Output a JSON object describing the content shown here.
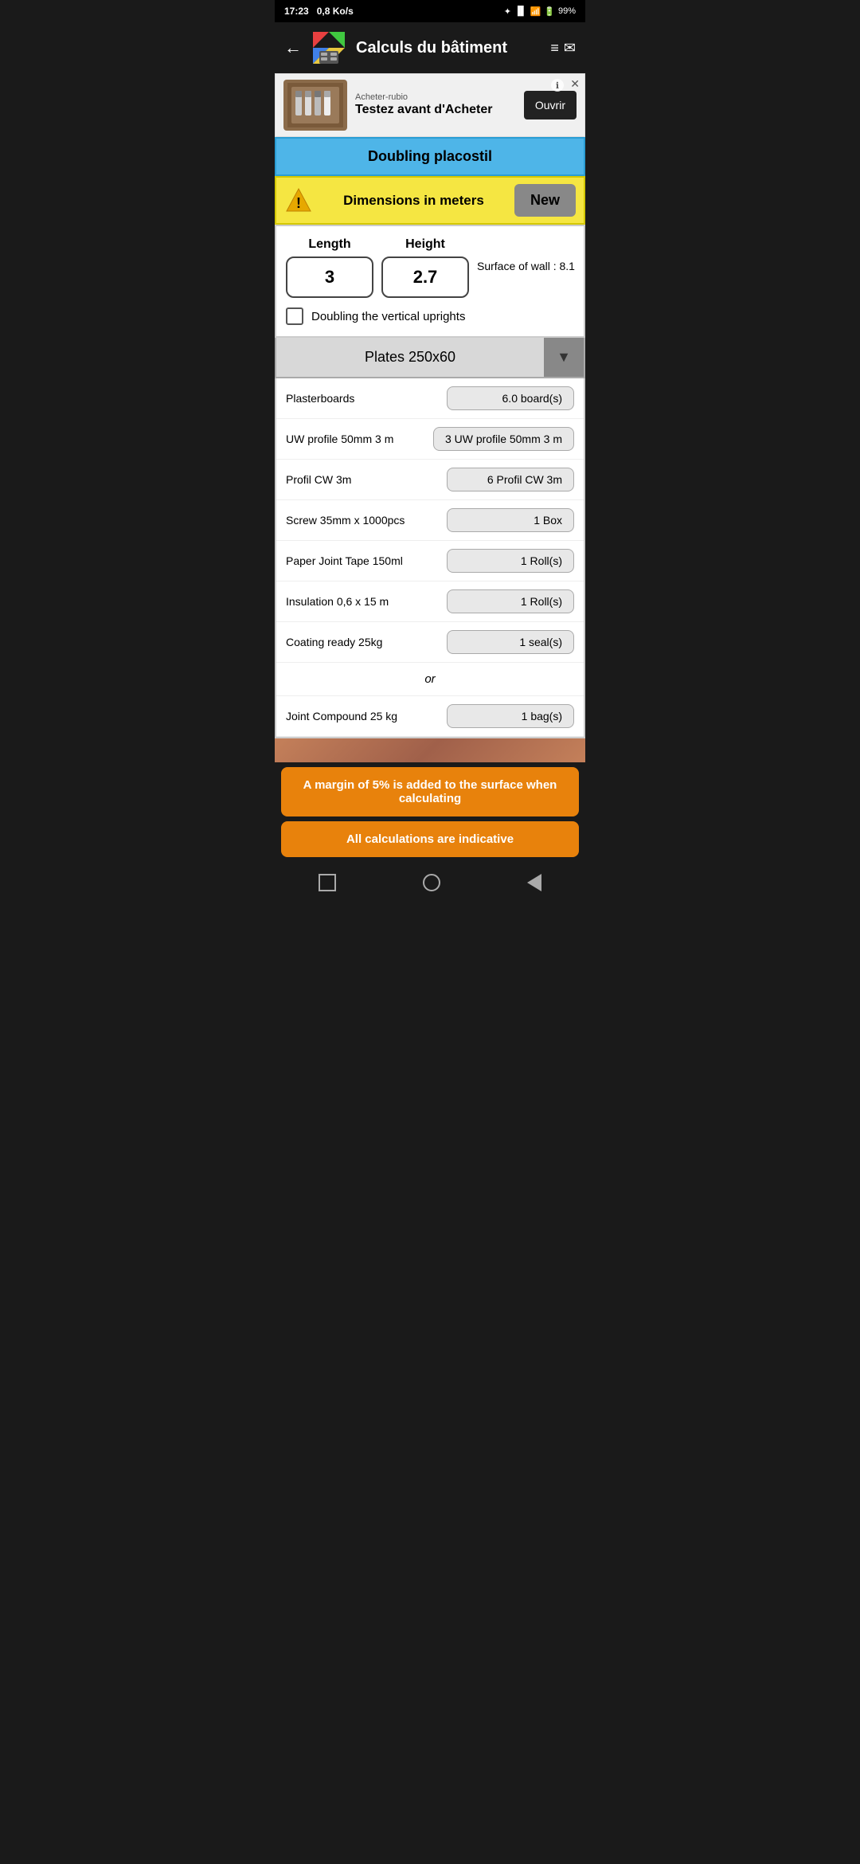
{
  "status_bar": {
    "time": "17:23",
    "network_speed": "0,8 Ko/s",
    "battery": "99%"
  },
  "header": {
    "back_label": "←",
    "title": "Calculs du bâtiment",
    "menu_icon": "≡✉"
  },
  "ad": {
    "source": "Acheter-rubio",
    "title": "Testez avant d'Acheter",
    "button_label": "Ouvrir",
    "info_label": "ℹ",
    "close_label": "✕"
  },
  "section": {
    "title": "Doubling placostil"
  },
  "dimensions_bar": {
    "text": "Dimensions in meters",
    "new_button": "New"
  },
  "inputs": {
    "length_label": "Length",
    "length_value": "3",
    "height_label": "Height",
    "height_value": "2.7",
    "surface_label": "Surface of wall :",
    "surface_value": "8.1",
    "checkbox_label": "Doubling the vertical uprights",
    "checkbox_checked": false
  },
  "dropdown": {
    "label": "Plates 250x60",
    "arrow": "▼"
  },
  "results": [
    {
      "label": "Plasterboards",
      "value": "6.0 board(s)"
    },
    {
      "label": "UW profile 50mm 3 m",
      "value": "3 UW profile 50mm 3 m"
    },
    {
      "label": "Profil CW 3m",
      "value": "6 Profil CW 3m"
    },
    {
      "label": "Screw 35mm x 1000pcs",
      "value": "1 Box"
    },
    {
      "label": "Paper Joint Tape 150ml",
      "value": "1 Roll(s)"
    },
    {
      "label": "Insulation 0,6 x 15 m",
      "value": "1 Roll(s)"
    },
    {
      "label": "Coating ready 25kg",
      "value": "1 seal(s)"
    }
  ],
  "or_text": "or",
  "joint_compound": {
    "label": "Joint Compound 25 kg",
    "value": "1 bag(s)"
  },
  "footer": {
    "margin_note": "A margin of 5% is added to the surface when calculating",
    "indicative_note": "All calculations are indicative"
  },
  "nav": {
    "square_label": "■",
    "circle_label": "●",
    "back_label": "◄"
  }
}
